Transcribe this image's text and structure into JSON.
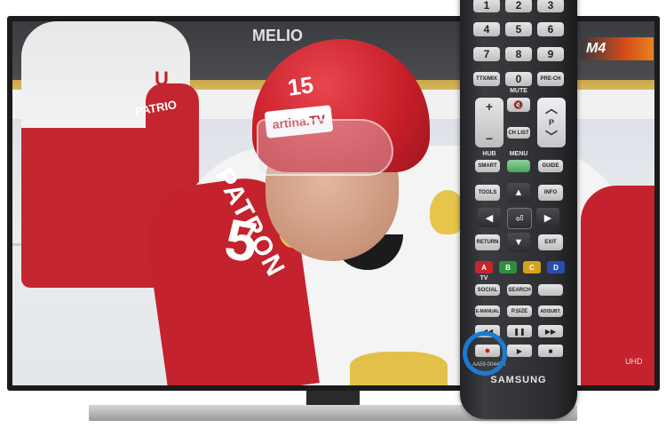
{
  "tv": {
    "channel_logo": "M4",
    "corner_logo": "UHD",
    "helmet_badge": "artina.TV",
    "helmet_number": "15",
    "jersey_name": "PATRON",
    "jersey_number": "5",
    "left_player_name": "PATRIO",
    "left_player_number": "U",
    "board_text": "MELIO"
  },
  "remote": {
    "brand": "SAMSUNG",
    "model": "AA59-00445A",
    "number_buttons": [
      "1",
      "2",
      "3",
      "4",
      "5",
      "6",
      "7",
      "8",
      "9",
      "0"
    ],
    "ttx_label": "TTX/MIX",
    "prech_label": "PRE-CH",
    "mute_label": "MUTE",
    "chlist_label": "CH LIST",
    "p_label": "P",
    "hub_label": "HUB",
    "menu_label": "MENU",
    "smart_label": "SMART",
    "guide_label": "GUIDE",
    "tools_label": "TOOLS",
    "info_label": "INFO",
    "return_label": "RETURN",
    "exit_label": "EXIT",
    "tv_label": "TV",
    "color_buttons": [
      "A",
      "B",
      "C",
      "D"
    ],
    "social_label": "SOCIAL",
    "search_label": "SEARCH",
    "emanual_label": "E-MANUAL",
    "psize_label": "P.SIZE",
    "adsubt_label": "AD/SUBT.",
    "colors": {
      "a": "#c8262c",
      "b": "#2f8f3a",
      "c": "#d6a21c",
      "d": "#2a4bb0",
      "highlight": "#1b7ad3"
    },
    "icons": [
      "mute-icon",
      "record-icon",
      "play-icon",
      "pause-icon",
      "stop-icon",
      "rewind-icon",
      "fast-forward-icon",
      "prev-icon",
      "next-icon",
      "arrow-up-icon",
      "arrow-down-icon",
      "arrow-left-icon",
      "arrow-right-icon",
      "enter-icon"
    ]
  }
}
